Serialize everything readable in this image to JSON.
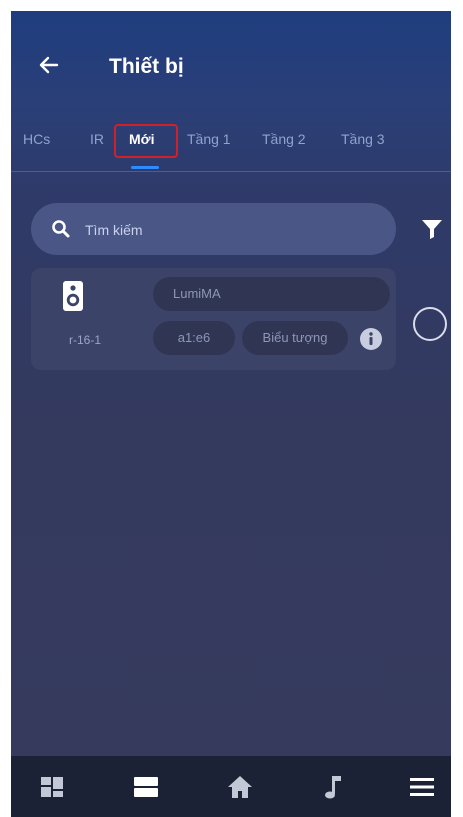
{
  "header": {
    "title": "Thiết bị"
  },
  "tabs": [
    {
      "label": "HCs"
    },
    {
      "label": "IR"
    },
    {
      "label": "Mới"
    },
    {
      "label": "Tầng 1"
    },
    {
      "label": "Tầng 2"
    },
    {
      "label": "Tầng 3"
    }
  ],
  "active_tab": "Mới",
  "search": {
    "placeholder": "Tìm kiếm",
    "value": ""
  },
  "device": {
    "icon": "speaker-icon",
    "id": "r-16-1",
    "name": "LumiMA",
    "code": "a1:e6",
    "icon_button": "Biểu tượng",
    "selected": false
  },
  "bottom_nav": [
    {
      "icon": "dashboard-icon"
    },
    {
      "icon": "rooms-icon"
    },
    {
      "icon": "home-icon"
    },
    {
      "icon": "music-note-icon"
    },
    {
      "icon": "menu-icon"
    }
  ],
  "colors": {
    "accent": "#2d8cff",
    "highlight_box": "#d0212a",
    "bottom_bar": "#1c2236"
  }
}
